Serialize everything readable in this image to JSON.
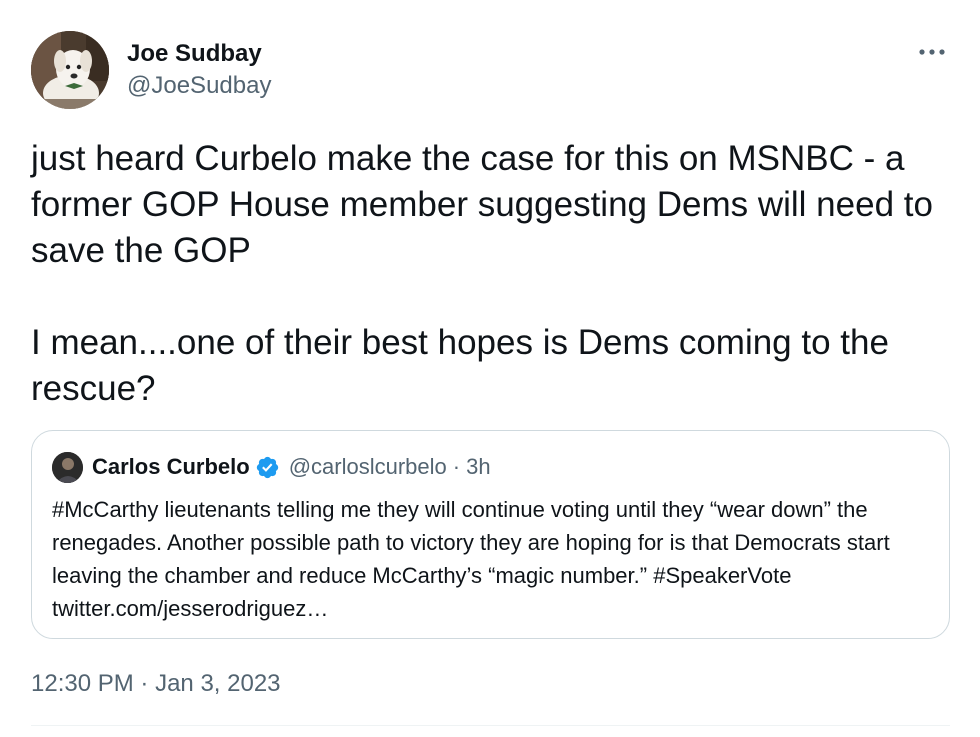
{
  "tweet": {
    "author": {
      "display_name": "Joe Sudbay",
      "handle": "@JoeSudbay"
    },
    "text": "just heard Curbelo make the case for this on MSNBC - a former GOP House member suggesting Dems will need to save the GOP\n\nI mean....one of their best hopes is Dems coming to the rescue?",
    "time": "12:30 PM",
    "separator": "·",
    "date": "Jan 3, 2023",
    "more_icon": "more-dots-icon"
  },
  "quoted_tweet": {
    "display_name": "Carlos Curbelo",
    "verified_icon": "verified-badge-icon",
    "handle": "@carloslcurbelo",
    "separator": "·",
    "time": "3h",
    "text": "#McCarthy lieutenants telling me they will continue voting until they “wear down” the renegades. Another possible path to victory they are hoping for is that Democrats start leaving the chamber and reduce McCarthy’s “magic number.” #SpeakerVote twitter.com/jesserodriguez…"
  },
  "colors": {
    "text_primary": "#0f1419",
    "text_secondary": "#536471",
    "border": "#cfd9de",
    "verified_blue": "#1d9bf0"
  }
}
